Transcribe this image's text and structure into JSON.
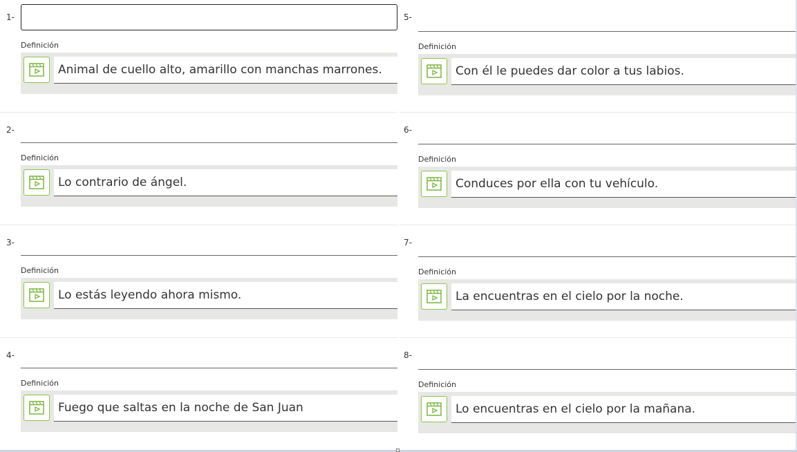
{
  "definition_label": "Definición",
  "icon": "video-play-icon",
  "accent": "#7cb342",
  "items": [
    {
      "num": "1-",
      "definition": "Animal de cuello alto, amarillo con manchas marrones.",
      "answer": ""
    },
    {
      "num": "2-",
      "definition": "Lo contrario de ángel.",
      "answer": ""
    },
    {
      "num": "3-",
      "definition": "Lo estás leyendo ahora mismo.",
      "answer": ""
    },
    {
      "num": "4-",
      "definition": "Fuego que saltas en la noche de San Juan",
      "answer": ""
    },
    {
      "num": "5-",
      "definition": "Con él  le puedes dar color a tus labios.",
      "answer": ""
    },
    {
      "num": "6-",
      "definition": "Conduces por ella con tu vehículo.",
      "answer": ""
    },
    {
      "num": "7-",
      "definition": "La encuentras en el cielo por la noche.",
      "answer": ""
    },
    {
      "num": "8-",
      "definition": "Lo encuentras en el cielo por la mañana.",
      "answer": ""
    }
  ]
}
